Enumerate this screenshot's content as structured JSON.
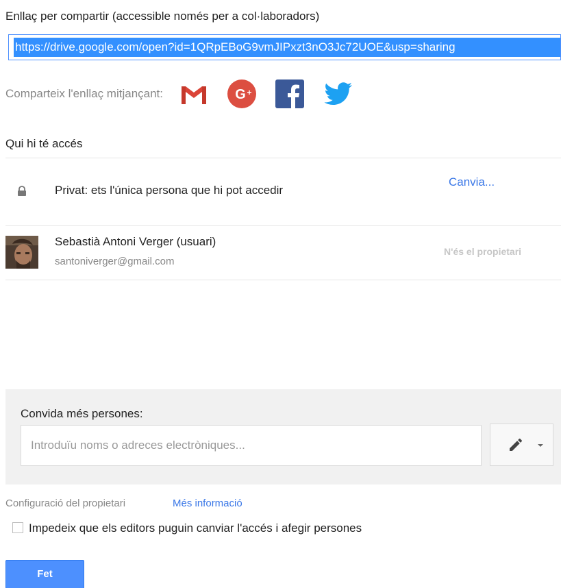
{
  "share_link": {
    "label": "Enllaç per compartir (accessible només per a col·laboradors)",
    "url": "https://drive.google.com/open?id=1QRpEBoG9vmJIPxzt3nO3Jc72UOE&usp=sharing"
  },
  "share_via": {
    "label": "Comparteix l'enllaç mitjançant:",
    "services": [
      {
        "name": "gmail",
        "icon": "gmail-icon",
        "color": "#db4437"
      },
      {
        "name": "google-plus",
        "icon": "google-plus-icon",
        "color": "#dc4e41"
      },
      {
        "name": "facebook",
        "icon": "facebook-icon",
        "color": "#3b5998"
      },
      {
        "name": "twitter",
        "icon": "twitter-icon",
        "color": "#1da1f2"
      }
    ]
  },
  "access": {
    "title": "Qui hi té accés",
    "private_text": "Privat: ets l'única persona que hi pot accedir",
    "change_label": "Canvia...",
    "user": {
      "name": "Sebastià Antoni Verger (usuari)",
      "email": "santoniverger@gmail.com",
      "role": "N'és el propietari"
    }
  },
  "invite": {
    "label": "Convida més persones:",
    "placeholder": "Introduïu noms o adreces electròniques...",
    "permission_icon": "pencil-icon"
  },
  "owner_settings": {
    "label": "Configuració del propietari",
    "more_info": "Més informació",
    "prevent_editors_label": "Impedeix que els editors puguin canviar l'accés i afegir persones",
    "prevent_editors_checked": false
  },
  "done_label": "Fet",
  "colors": {
    "accent": "#4d90fe",
    "link": "#3b78e7",
    "selection": "#3390ff"
  }
}
